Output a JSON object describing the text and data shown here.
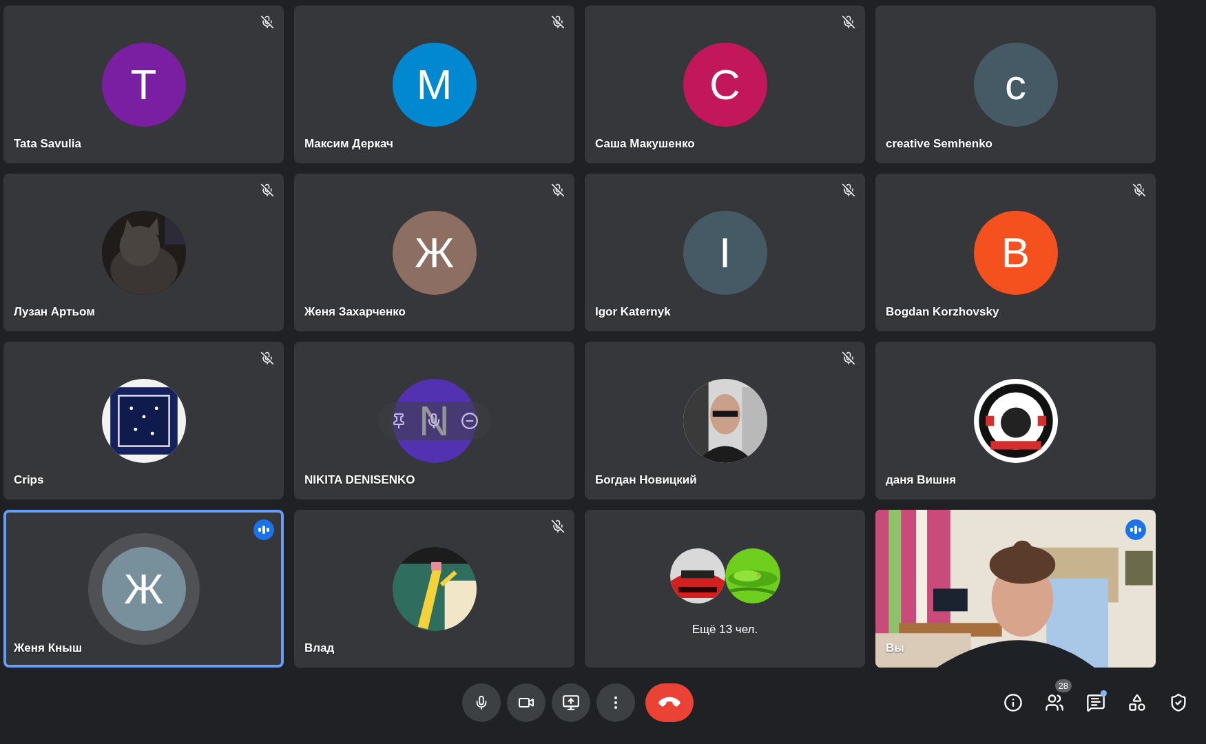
{
  "tiles": [
    {
      "kind": "participant",
      "name": "Tata Savulia",
      "muted": true,
      "speaking": false,
      "selected": false,
      "hovered": false,
      "avatar": {
        "kind": "initial",
        "letter": "T",
        "color": "#7b1fa2"
      }
    },
    {
      "kind": "participant",
      "name": "Максим Деркач",
      "muted": true,
      "speaking": false,
      "selected": false,
      "hovered": false,
      "avatar": {
        "kind": "initial",
        "letter": "M",
        "color": "#0288d1"
      }
    },
    {
      "kind": "participant",
      "name": "Саша Макушенко",
      "muted": true,
      "speaking": false,
      "selected": false,
      "hovered": false,
      "avatar": {
        "kind": "initial",
        "letter": "C",
        "color": "#c2185b"
      }
    },
    {
      "kind": "participant",
      "name": "creative Semhenko",
      "muted": false,
      "speaking": false,
      "selected": false,
      "hovered": false,
      "avatar": {
        "kind": "initial",
        "letter": "c",
        "color": "#455a64"
      }
    },
    {
      "kind": "participant",
      "name": "Лузан Артьом",
      "muted": true,
      "speaking": false,
      "selected": false,
      "hovered": false
    },
    {
      "kind": "participant",
      "name": "Женя Захарченко",
      "muted": true,
      "speaking": false,
      "selected": false,
      "hovered": false,
      "avatar": {
        "kind": "initial",
        "letter": "Ж",
        "color": "#8d6e63"
      }
    },
    {
      "kind": "participant",
      "name": "Igor Katernyk",
      "muted": true,
      "speaking": false,
      "selected": false,
      "hovered": false,
      "avatar": {
        "kind": "initial",
        "letter": "I",
        "color": "#455a64"
      }
    },
    {
      "kind": "participant",
      "name": "Bogdan Korzhovsky",
      "muted": true,
      "speaking": false,
      "selected": false,
      "hovered": false,
      "avatar": {
        "kind": "initial",
        "letter": "B",
        "color": "#f4511e"
      }
    },
    {
      "kind": "participant",
      "name": "Crips",
      "muted": true,
      "speaking": false,
      "selected": false,
      "hovered": false
    },
    {
      "kind": "participant",
      "name": "NIKITA DENISENKO",
      "muted": false,
      "speaking": false,
      "selected": false,
      "hovered": true,
      "avatar": {
        "kind": "initial",
        "letter": "N",
        "color": "#5232b0"
      }
    },
    {
      "kind": "participant",
      "name": "Богдан Новицкий",
      "muted": true,
      "speaking": false,
      "selected": false,
      "hovered": false
    },
    {
      "kind": "participant",
      "name": "даня Вишня",
      "muted": false,
      "speaking": false,
      "selected": false,
      "hovered": false
    },
    {
      "kind": "participant",
      "name": "Женя Кныш",
      "muted": false,
      "speaking": true,
      "selected": true,
      "hovered": false,
      "avatar": {
        "kind": "initial",
        "letter": "Ж",
        "color": "#78909c"
      }
    },
    {
      "kind": "participant",
      "name": "Влад",
      "muted": true,
      "speaking": false,
      "selected": false,
      "hovered": false
    },
    {
      "kind": "more",
      "label": "Ещё 13 чел."
    },
    {
      "kind": "self",
      "name": "Вы",
      "muted": false,
      "speaking": true,
      "selected": false
    }
  ],
  "toolbar": {
    "people_count": "28",
    "chat_unread": true
  }
}
